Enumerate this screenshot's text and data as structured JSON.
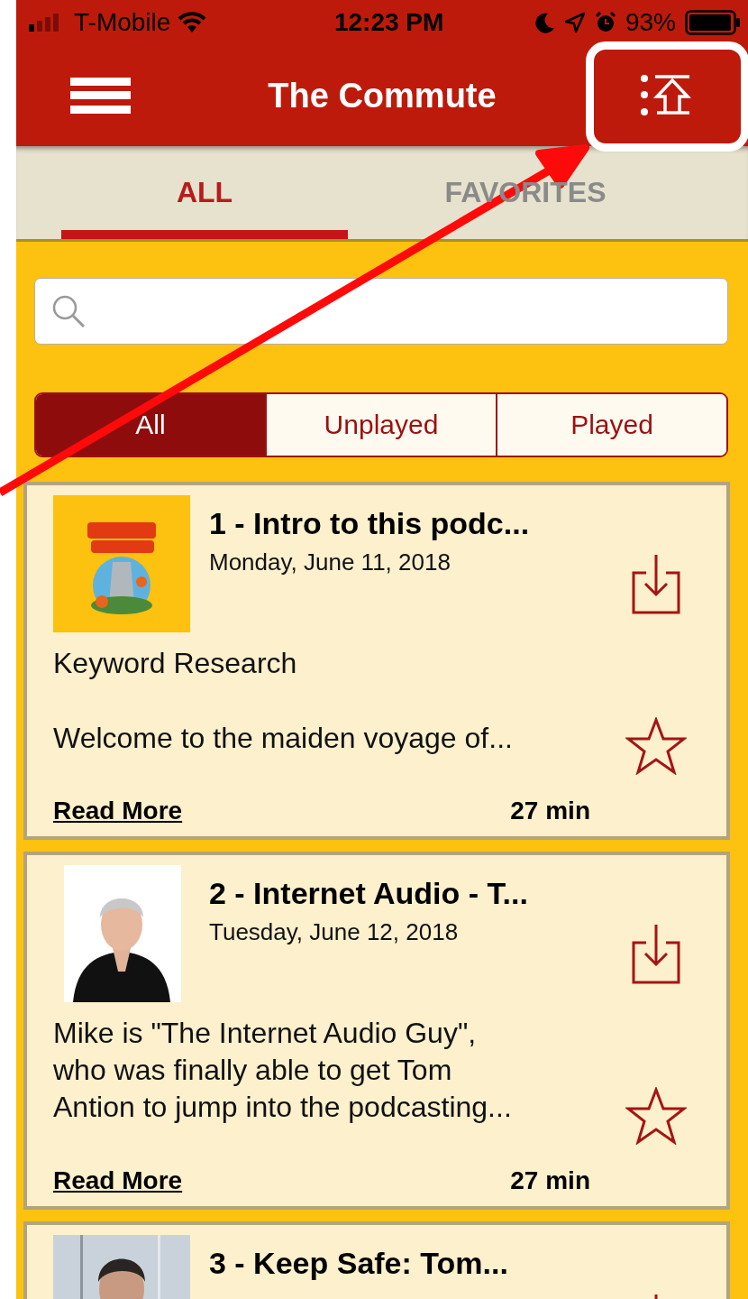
{
  "status_bar": {
    "carrier": "T-Mobile",
    "time": "12:23 PM",
    "battery": "93%"
  },
  "header": {
    "title": "The Commute"
  },
  "tabs": [
    {
      "label": "ALL",
      "selected": true
    },
    {
      "label": "FAVORITES",
      "selected": false
    }
  ],
  "filters": [
    {
      "label": "All",
      "selected": true
    },
    {
      "label": "Unplayed",
      "selected": false
    },
    {
      "label": "Played",
      "selected": false
    }
  ],
  "episodes": [
    {
      "title": "1 - Intro to this podc...",
      "date": "Monday, June 11, 2018",
      "subtitle": "Keyword Research",
      "description": "Welcome to the maiden voyage of...",
      "read_more": "Read More",
      "duration": "27 min",
      "favorite": false,
      "image": {
        "kind": "logo"
      }
    },
    {
      "title": "2 - Internet Audio - T...",
      "date": "Tuesday, June 12, 2018",
      "description": "Mike is \"The Internet Audio Guy\",\nwho was finally able to get Tom\nAntion to jump into the podcasting...",
      "read_more": "Read More",
      "duration": "27 min",
      "favorite": false,
      "image": {
        "kind": "portrait"
      }
    },
    {
      "title": "3 - Keep Safe: Tom...",
      "image": {
        "kind": "wall"
      }
    }
  ]
}
